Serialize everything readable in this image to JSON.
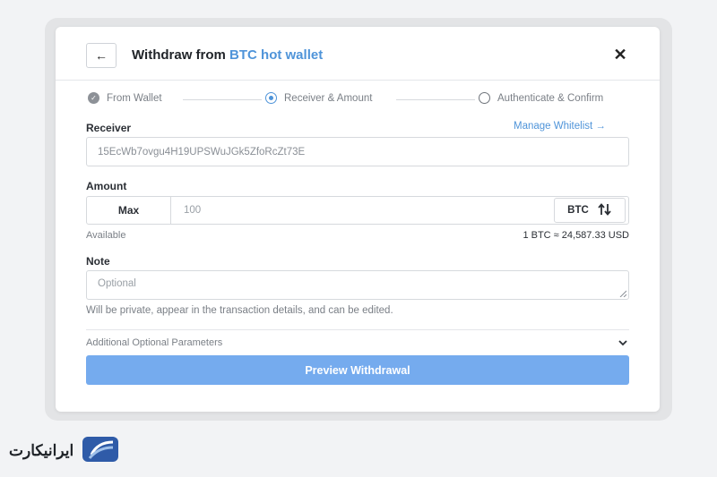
{
  "header": {
    "back_icon": "arrow-left-icon",
    "title_prefix": "Withdraw from ",
    "title_accent": "BTC hot wallet",
    "close_icon": "close-icon",
    "accent_color": "#4f94d9"
  },
  "steps": [
    {
      "label": "From Wallet",
      "state": "done"
    },
    {
      "label": "Receiver & Amount",
      "state": "active"
    },
    {
      "label": "Authenticate & Confirm",
      "state": "todo"
    }
  ],
  "receiver": {
    "label": "Receiver",
    "manage_link": "Manage Whitelist →",
    "value": "15EcWb7ovgu4H19UPSWuJGk5ZfoRcZt73E"
  },
  "amount": {
    "label": "Amount",
    "max_label": "Max",
    "value": "100",
    "unit": "BTC",
    "swap_icon": "swap-vertical-icon",
    "available_label": "Available",
    "rate": "1 BTC ≈ 24,587.33 USD"
  },
  "note": {
    "label": "Note",
    "placeholder": "Optional",
    "helper": "Will be private, appear in the transaction details, and can be edited."
  },
  "advanced": {
    "label": "Additional Optional Parameters",
    "chevron_icon": "chevron-down-icon"
  },
  "primary_button": {
    "label": "Preview Withdrawal",
    "color": "#75abee"
  },
  "watermark": {
    "text": "ایرانیکارت",
    "logo_icon": "card-logo-icon"
  }
}
